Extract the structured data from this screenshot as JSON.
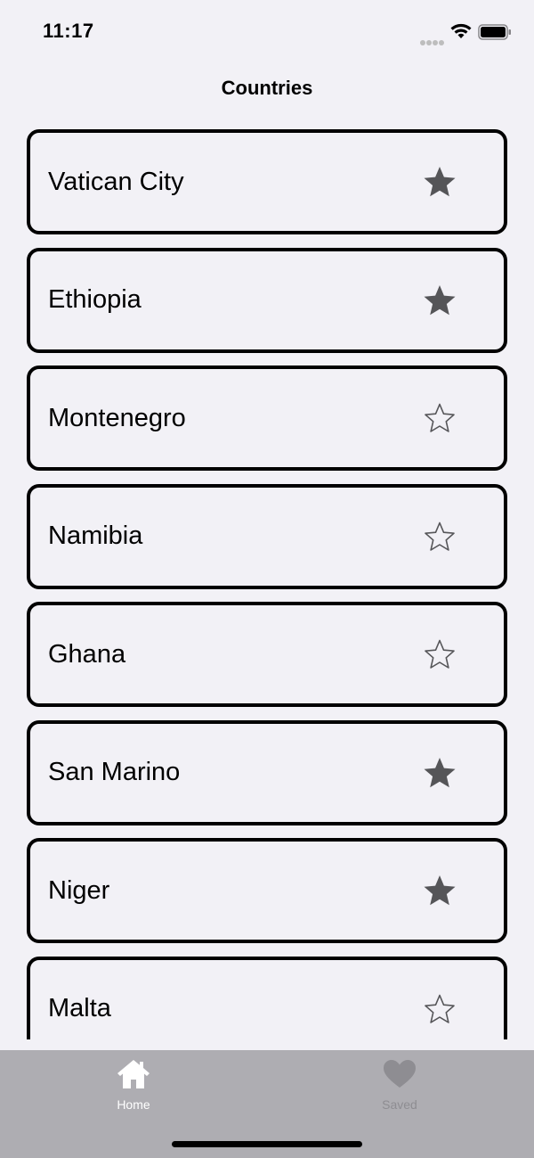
{
  "status_bar": {
    "time": "11:17"
  },
  "nav": {
    "title": "Countries"
  },
  "countries": [
    {
      "name": "Vatican City",
      "starred": true
    },
    {
      "name": "Ethiopia",
      "starred": true
    },
    {
      "name": "Montenegro",
      "starred": false
    },
    {
      "name": "Namibia",
      "starred": false
    },
    {
      "name": "Ghana",
      "starred": false
    },
    {
      "name": "San Marino",
      "starred": true
    },
    {
      "name": "Niger",
      "starred": true
    },
    {
      "name": "Malta",
      "starred": false
    }
  ],
  "tab_bar": {
    "tabs": [
      {
        "label": "Home",
        "icon": "house-icon",
        "active": true
      },
      {
        "label": "Saved",
        "icon": "heart-icon",
        "active": false
      }
    ]
  },
  "colors": {
    "background": "#F2F1F6",
    "star_filled": "#555558",
    "star_outline": "#555558",
    "tab_bar": "#AEADB2",
    "tab_active": "#FFFFFF",
    "tab_inactive": "#8E8D92"
  }
}
